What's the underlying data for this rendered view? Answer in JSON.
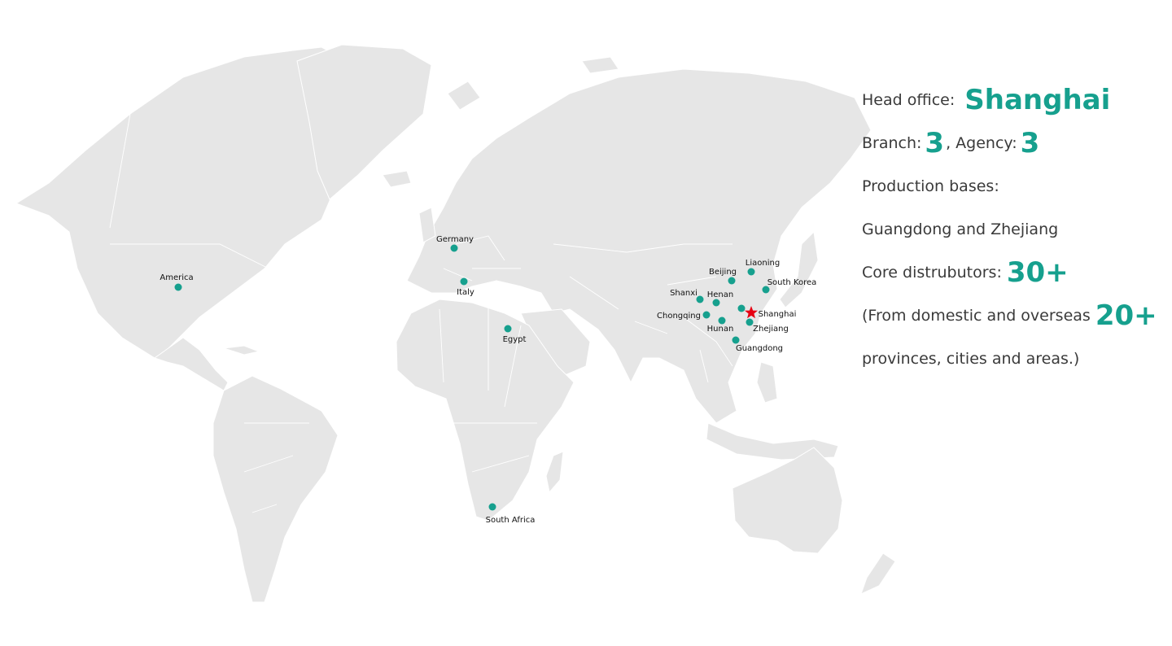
{
  "map": {
    "markers": [
      {
        "name": "america",
        "label": "America"
      },
      {
        "name": "germany",
        "label": "Germany"
      },
      {
        "name": "italy",
        "label": "Italy"
      },
      {
        "name": "egypt",
        "label": "Egypt"
      },
      {
        "name": "south-africa",
        "label": "South Africa"
      },
      {
        "name": "liaoning",
        "label": "Liaoning"
      },
      {
        "name": "beijing",
        "label": "Beijing"
      },
      {
        "name": "south-korea",
        "label": "South Korea"
      },
      {
        "name": "shanxi",
        "label": "Shanxi"
      },
      {
        "name": "henan",
        "label": "Henan"
      },
      {
        "name": "shanghai",
        "label": "Shanghai",
        "icon": "star-icon"
      },
      {
        "name": "chongqing",
        "label": "Chongqing"
      },
      {
        "name": "hunan",
        "label": "Hunan"
      },
      {
        "name": "zhejiang",
        "label": "Zhejiang"
      },
      {
        "name": "guangdong",
        "label": "Guangdong"
      }
    ],
    "colors": {
      "land": "#e6e6e6",
      "marker": "#16a08e",
      "headquarters": "#e60012",
      "highlight": "#16a08e"
    }
  },
  "info": {
    "head_office_label": "Head office:",
    "head_office_value": "Shanghai",
    "branch_label": "Branch:",
    "branch_value": "3",
    "agency_label": ", Agency:",
    "agency_value": "3",
    "production_label": "Production bases:",
    "production_value": "Guangdong and Zhejiang",
    "core_label": "Core distrubutors:",
    "core_value": "30+",
    "from_label": "(From domestic and overseas",
    "from_value": "20+",
    "provinces_text": "provinces, cities and areas.)"
  }
}
